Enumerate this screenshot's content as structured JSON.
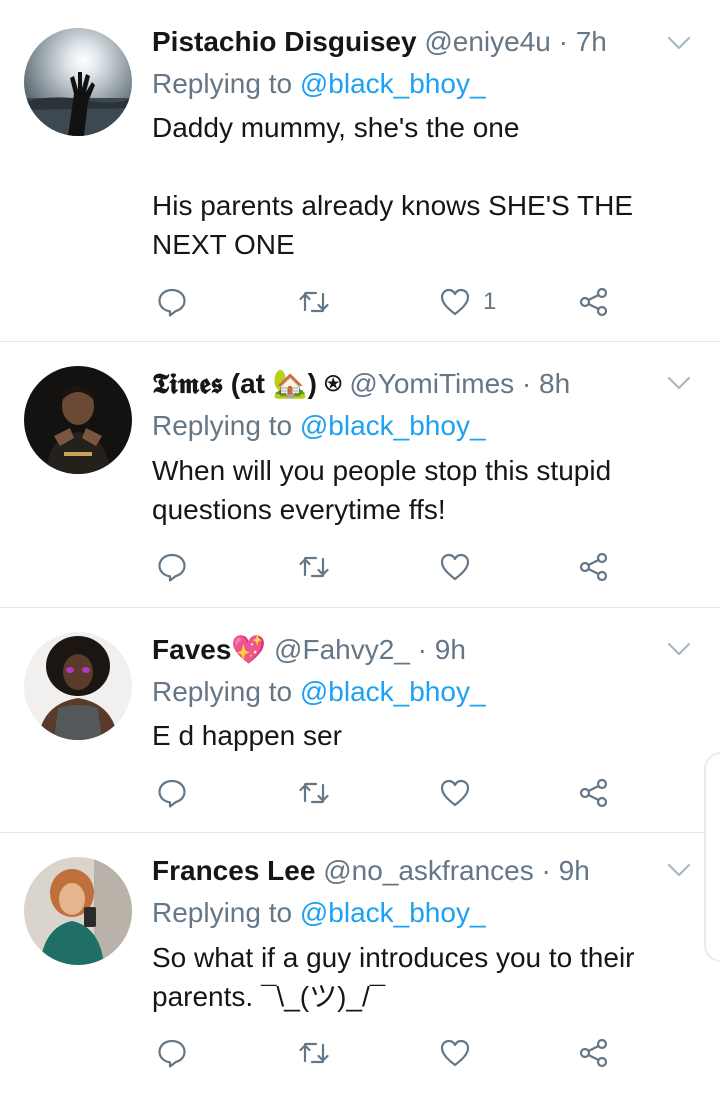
{
  "tweets": [
    {
      "name": "Pistachio Disguisey",
      "handle": "@eniye4u",
      "separator": "·",
      "time": "7h",
      "replying_prefix": "Replying to ",
      "replying_to": "@black_bhoy_",
      "text": "Daddy mummy, she's the one\n\nHis parents already knows SHE'S THE NEXT ONE",
      "like_count": "1"
    },
    {
      "name": "𝕿𝖎𝖒𝖊𝖘 (at 🏡) ⍟",
      "handle": "@YomiTimes",
      "separator": "·",
      "time": "8h",
      "replying_prefix": "Replying to ",
      "replying_to": "@black_bhoy_",
      "text": "When will you people stop this stupid questions everytime ffs!",
      "like_count": ""
    },
    {
      "name": "Faves💖",
      "handle": "@Fahvy2_",
      "separator": "·",
      "time": "9h",
      "replying_prefix": "Replying to ",
      "replying_to": "@black_bhoy_",
      "text": "E d happen ser",
      "like_count": ""
    },
    {
      "name": "Frances Lee",
      "handle": "@no_askfrances",
      "separator": "·",
      "time": "9h",
      "replying_prefix": "Replying to ",
      "replying_to": "@black_bhoy_",
      "text": "So what if a guy introduces you to their parents. ¯\\_(ツ)_/¯",
      "like_count": ""
    }
  ],
  "icons": {
    "reply": "reply-icon",
    "retweet": "retweet-icon",
    "like": "heart-icon",
    "share": "share-icon",
    "menu": "chevron-down-icon"
  },
  "colors": {
    "link": "#1da1f2",
    "muted": "#657786",
    "text": "#14171a",
    "divider": "#e1e8ed"
  }
}
